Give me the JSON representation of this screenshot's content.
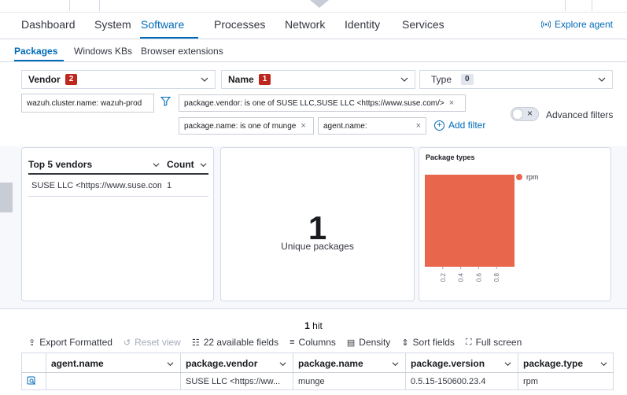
{
  "main_tabs": [
    "Dashboard",
    "System",
    "Software",
    "Processes",
    "Network",
    "Identity",
    "Services"
  ],
  "explore_agent": "Explore agent",
  "sub_tabs": [
    "Packages",
    "Windows KBs",
    "Browser extensions"
  ],
  "dropdowns": {
    "vendor": {
      "label": "Vendor",
      "count": "2"
    },
    "name": {
      "label": "Name",
      "count": "1"
    },
    "type": {
      "label": "Type",
      "count": "0"
    }
  },
  "filters": {
    "cluster": "wazuh.cluster.name: wazuh-prod",
    "vendor": "package.vendor: is one of SUSE LLC,SUSE LLC <https://www.suse.com/>",
    "name": "package.name: is one of munge",
    "agent": "agent.name:",
    "add_filter": "Add filter",
    "advanced": "Advanced filters"
  },
  "top_vendors": {
    "header_vendor": "Top 5 vendors",
    "header_count": "Count",
    "rows": [
      {
        "vendor": "SUSE LLC <https://www.suse.com/>",
        "count": "1"
      }
    ]
  },
  "metric": {
    "value": "1",
    "label": "Unique packages"
  },
  "package_types": {
    "title": "Package types",
    "chart_data": {
      "type": "bar",
      "title": "Package types",
      "categories": [
        "rpm"
      ],
      "values": [
        1
      ],
      "xlim": [
        0,
        1
      ],
      "ticks": [
        "0.2",
        "0.4",
        "0.6",
        "0.8"
      ],
      "legend": [
        {
          "name": "rpm",
          "color": "#e7664c"
        }
      ],
      "color": "#e7664c"
    }
  },
  "results": {
    "hits_count": "1",
    "hits_label": "hit",
    "toolbar": {
      "export": "Export Formatted",
      "reset": "Reset view",
      "fields": "22 available fields",
      "columns": "Columns",
      "density": "Density",
      "sort": "Sort fields",
      "fullscreen": "Full screen"
    },
    "columns": [
      "agent.name",
      "package.vendor",
      "package.name",
      "package.version",
      "package.type"
    ],
    "rows": [
      {
        "agent_name": "",
        "vendor": "SUSE LLC <https://ww...",
        "name": "munge",
        "version": "0.5.15-150600.23.4",
        "type": "rpm"
      }
    ]
  }
}
